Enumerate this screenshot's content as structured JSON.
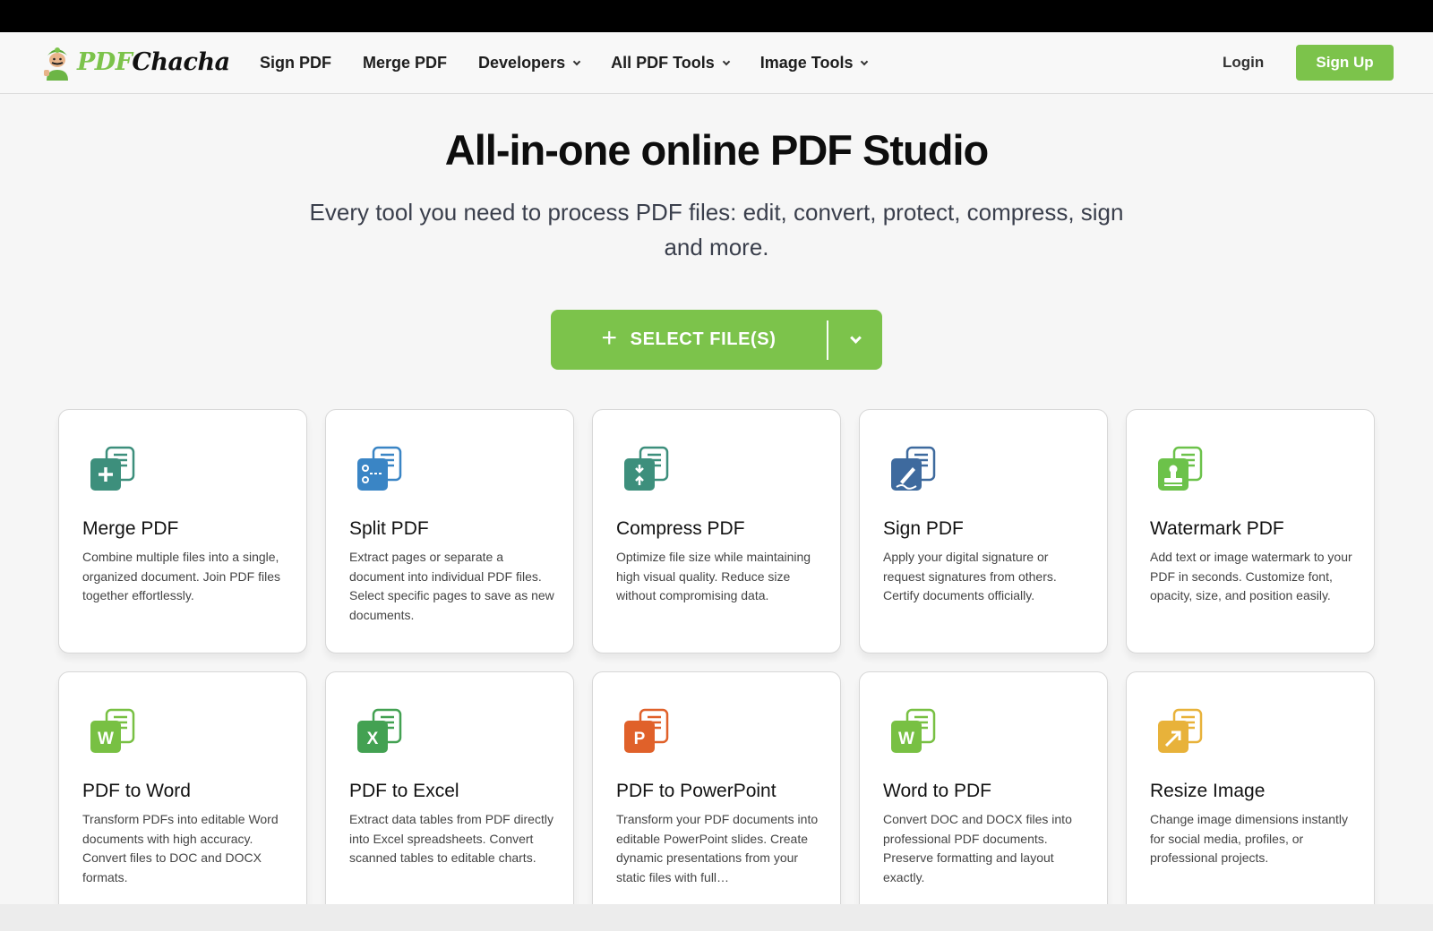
{
  "brand": {
    "name_part1": "PDF",
    "name_part2": "Chacha",
    "logo_icon": "mascot-icon"
  },
  "nav": {
    "links": [
      {
        "label": "Sign PDF",
        "dropdown": false
      },
      {
        "label": "Merge PDF",
        "dropdown": false
      },
      {
        "label": "Developers",
        "dropdown": true
      },
      {
        "label": "All PDF Tools",
        "dropdown": true
      },
      {
        "label": "Image Tools",
        "dropdown": true
      }
    ],
    "login": "Login",
    "signup": "Sign Up"
  },
  "hero": {
    "title": "All-in-one online PDF Studio",
    "subtitle": "Every tool you need to process PDF files: edit, convert, protect, compress, sign and more."
  },
  "upload": {
    "label": "SELECT FILE(S)"
  },
  "colors": {
    "accent": "#7cc34b",
    "text": "#121212"
  },
  "tools": [
    {
      "title": "Merge PDF",
      "desc": "Combine multiple files into a single, organized document. Join PDF files together effortlessly.",
      "icon": "merge-pdf-icon",
      "color": "#3d8f7c",
      "glyph": "+"
    },
    {
      "title": "Split PDF",
      "desc": "Extract pages or separate a document into individual PDF files. Select specific pages to save as new documents.",
      "icon": "split-pdf-icon",
      "color": "#3a85c5",
      "glyph": "split"
    },
    {
      "title": "Compress PDF",
      "desc": "Optimize file size while maintaining high visual quality. Reduce size without compromising data.",
      "icon": "compress-pdf-icon",
      "color": "#3d8f7c",
      "glyph": "compress"
    },
    {
      "title": "Sign PDF",
      "desc": "Apply your digital signature or request signatures from others. Certify documents officially.",
      "icon": "sign-pdf-icon",
      "color": "#3e6a9e",
      "glyph": "sign"
    },
    {
      "title": "Watermark PDF",
      "desc": "Add text or image watermark to your PDF in seconds. Customize font, opacity, size, and position easily.",
      "icon": "watermark-pdf-icon",
      "color": "#6cc24a",
      "glyph": "stamp"
    },
    {
      "title": "PDF to Word",
      "desc": "Transform PDFs into editable Word documents with high accuracy. Convert files to DOC and DOCX formats.",
      "icon": "pdf-to-word-icon",
      "color": "#78c043",
      "glyph": "W"
    },
    {
      "title": "PDF to Excel",
      "desc": "Extract data tables from PDF directly into Excel spreadsheets. Convert scanned tables to editable charts.",
      "icon": "pdf-to-excel-icon",
      "color": "#43a152",
      "glyph": "X"
    },
    {
      "title": "PDF to PowerPoint",
      "desc": "Transform your PDF documents into editable PowerPoint slides. Create dynamic presentations from your static files with full…",
      "icon": "pdf-to-powerpoint-icon",
      "color": "#e0612a",
      "glyph": "P"
    },
    {
      "title": "Word to PDF",
      "desc": "Convert DOC and DOCX files into professional PDF documents. Preserve formatting and layout exactly.",
      "icon": "word-to-pdf-icon",
      "color": "#78c043",
      "glyph": "W"
    },
    {
      "title": "Resize Image",
      "desc": "Change image dimensions instantly for social media, profiles, or professional projects.",
      "icon": "resize-image-icon",
      "color": "#e8b23a",
      "glyph": "resize"
    }
  ]
}
